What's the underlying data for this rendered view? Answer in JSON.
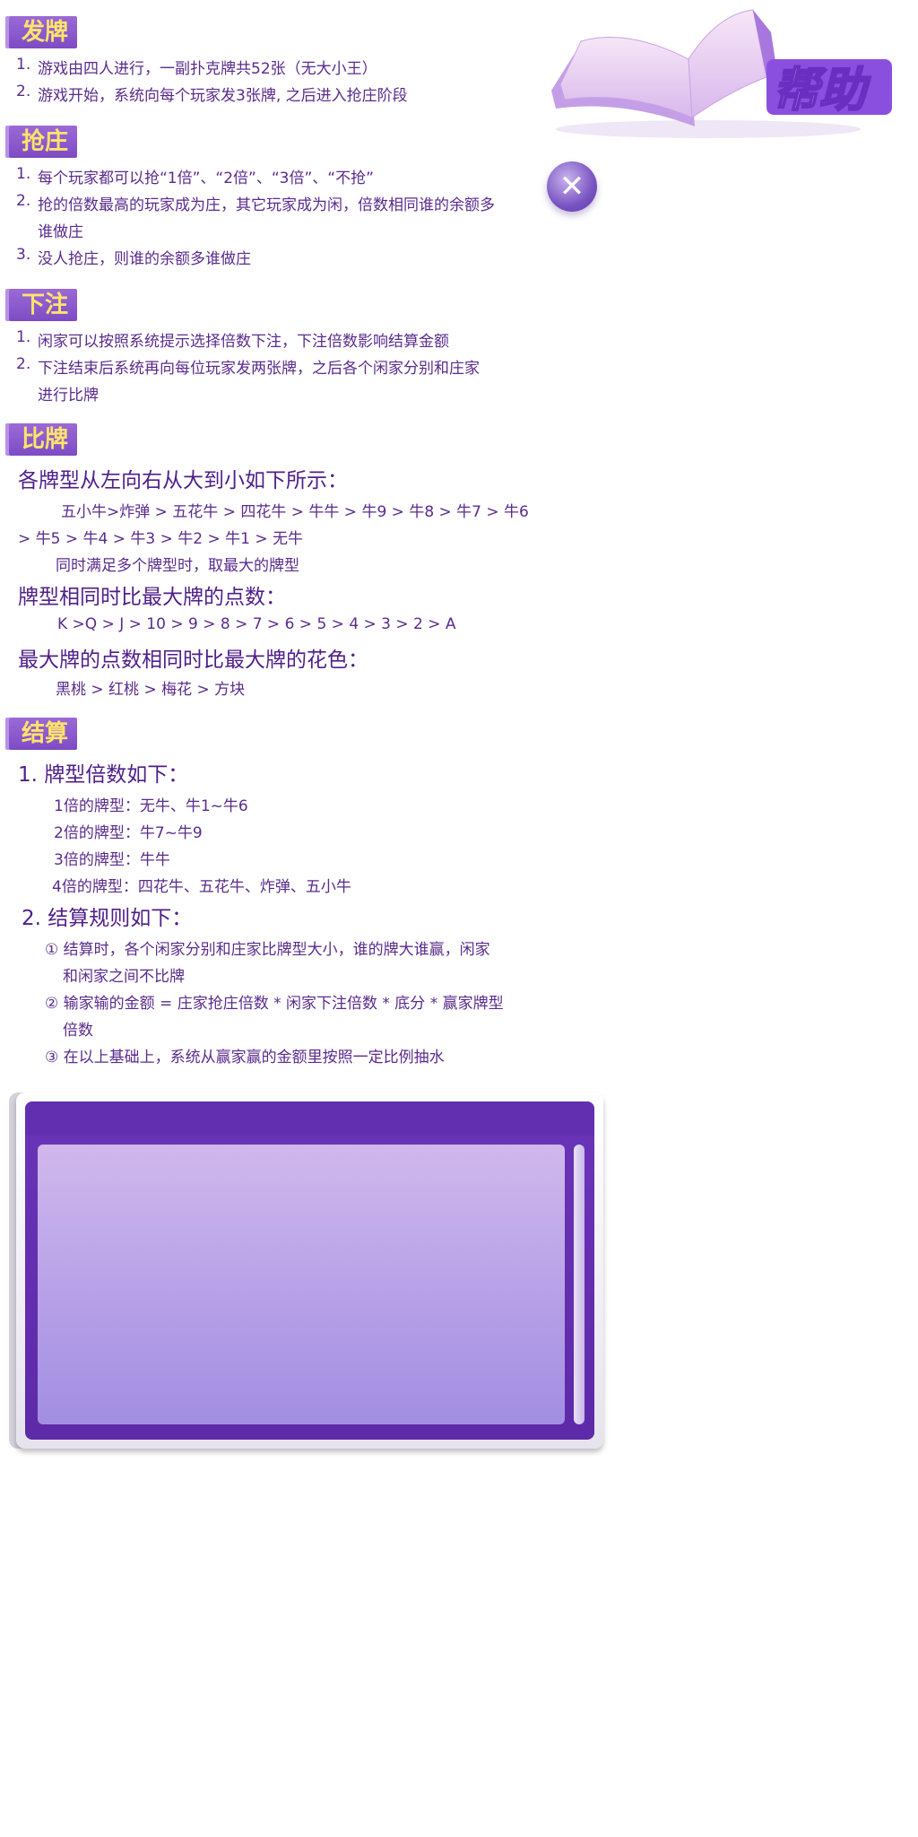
{
  "header": {
    "title": "帮助",
    "close_label": "✕"
  },
  "sections": {
    "deal": {
      "title": "发牌",
      "items": [
        {
          "n": "1.",
          "text": "游戏由四人进行，一副扑克牌共52张（无大小王）"
        },
        {
          "n": "2.",
          "text": "游戏开始，系统向每个玩家发3张牌, 之后进入抢庄阶段"
        }
      ]
    },
    "grab": {
      "title": "抢庄",
      "items": [
        {
          "n": "1.",
          "text": "每个玩家都可以抢“1倍”、“2倍”、“3倍”、“不抢”"
        },
        {
          "n": "2.",
          "text": "抢的倍数最高的玩家成为庄，其它玩家成为闲，倍数相同谁的余额多",
          "cont": "谁做庄"
        },
        {
          "n": "3.",
          "text": "没人抢庄，则谁的余额多谁做庄"
        }
      ]
    },
    "bet": {
      "title": "下注",
      "items": [
        {
          "n": "1.",
          "text": "闲家可以按照系统提示选择倍数下注，下注倍数影响结算金额"
        },
        {
          "n": "2.",
          "text": "下注结束后系统再向每位玩家发两张牌，之后各个闲家分别和庄家",
          "cont": "进行比牌"
        }
      ]
    },
    "compare": {
      "title": "比牌",
      "h1": "各牌型从左向右从大到小如下所示：",
      "order1": "五小牛>炸弹 > 五花牛 > 四花牛 > 牛牛 > 牛9 > 牛8 > 牛7 > 牛6",
      "order2": "> 牛5 > 牛4 > 牛3 > 牛2 > 牛1 > 无牛",
      "note": "同时满足多个牌型时，取最大的牌型",
      "h2": "牌型相同时比最大牌的点数：",
      "points": "K >Q > J > 10 > 9 > 8 > 7 > 6 > 5 > 4 > 3 > 2 > A",
      "h3": "最大牌的点数相同时比最大牌的花色：",
      "suits": "黑桃 > 红桃 > 梅花 > 方块"
    },
    "settle": {
      "title": "结算",
      "h1": "1. 牌型倍数如下：",
      "m1": "1倍的牌型：无牛、牛1~牛6",
      "m2": "2倍的牌型：牛7~牛9",
      "m3": "3倍的牌型：牛牛",
      "m4": "4倍的牌型：四花牛、五花牛、炸弹、五小牛",
      "h2": "2. 结算规则如下：",
      "r1a": "① 结算时，各个闲家分别和庄家比牌型大小，谁的牌大谁赢，闲家",
      "r1b": "和闲家之间不比牌",
      "r2a": "② 输家输的金额 = 庄家抢庄倍数 * 闲家下注倍数 * 底分 * 赢家牌型",
      "r2b": "倍数",
      "r3": "③ 在以上基础上，系统从赢家赢的金额里按照一定比例抽水"
    }
  },
  "colors": {
    "accent": "#7d4cc4",
    "tag_text": "#ffe36b",
    "text": "#5a2b8c"
  }
}
